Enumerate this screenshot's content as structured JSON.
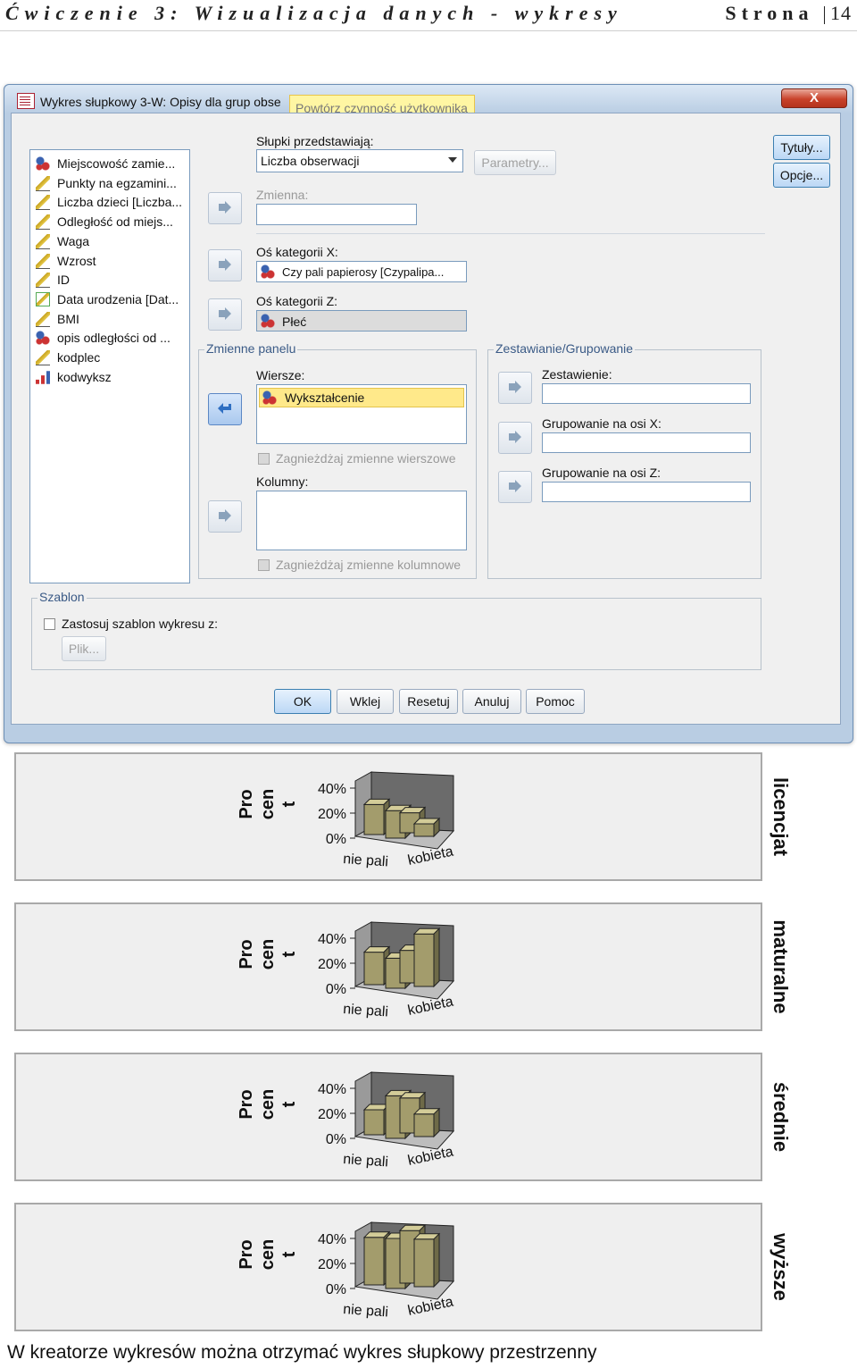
{
  "page_header": {
    "title": "Ćwiczenie 3: Wizualizacja danych - wykresy",
    "page_label": "Strona",
    "page_number": "14"
  },
  "dialog": {
    "title": "Wykres słupkowy 3-W: Opisy dla grup obse",
    "tooltip": "Powtórz czynność użytkownika",
    "close_icon": "X",
    "variables": [
      {
        "label": "Miejscowość zamie...",
        "icon": "nominal-icon"
      },
      {
        "label": "Punkty na egzamini...",
        "icon": "scale-icon"
      },
      {
        "label": "Liczba dzieci [Liczba...",
        "icon": "scale-icon"
      },
      {
        "label": "Odległość od miejs...",
        "icon": "scale-icon"
      },
      {
        "label": "Waga",
        "icon": "scale-icon"
      },
      {
        "label": "Wzrost",
        "icon": "scale-icon"
      },
      {
        "label": "ID",
        "icon": "scale-icon"
      },
      {
        "label": "Data urodzenia [Dat...",
        "icon": "date-icon"
      },
      {
        "label": "BMI",
        "icon": "scale-icon"
      },
      {
        "label": "opis odległości od ...",
        "icon": "nominal-icon"
      },
      {
        "label": "kodplec",
        "icon": "scale-icon"
      },
      {
        "label": "kodwyksz",
        "icon": "ordinal-icon"
      }
    ],
    "bars_represent_label": "Słupki przedstawiają:",
    "bars_represent_value": "Liczba obserwacji",
    "parameters_button": "Parametry...",
    "variable_label": "Zmienna:",
    "category_x_label": "Oś kategorii X:",
    "category_x_value": "Czy pali papierosy [Czypalipa...",
    "category_z_label": "Oś kategorii Z:",
    "category_z_value": "Płeć",
    "panel_group_title": "Zmienne panelu",
    "rows_label": "Wiersze:",
    "rows_value": "Wykształcenie",
    "nest_rows_label": "Zagnieżdżaj zmienne wierszowe",
    "columns_label": "Kolumny:",
    "nest_columns_label": "Zagnieżdżaj zmienne kolumnowe",
    "stack_group_title": "Zestawianie/Grupowanie",
    "stack_label": "Zestawienie:",
    "group_x_label": "Grupowanie na osi X:",
    "group_z_label": "Grupowanie na osi Z:",
    "titles_button": "Tytuły...",
    "options_button": "Opcje...",
    "template_group_title": "Szablon",
    "template_check_label": "Zastosuj szablon wykresu z:",
    "file_button": "Plik...",
    "ok_button": "OK",
    "paste_button": "Wklej",
    "reset_button": "Resetuj",
    "cancel_button": "Anuluj",
    "help_button": "Pomoc"
  },
  "chart_data": [
    {
      "type": "bar",
      "panel": "licencjat",
      "ylabel": "Pro cen t",
      "yticks": [
        "40%",
        "20%",
        "0%"
      ],
      "xticks": [
        "nie pali",
        "kobieta"
      ],
      "ylim": [
        0,
        40
      ],
      "values": [
        24,
        22,
        16,
        10
      ]
    },
    {
      "type": "bar",
      "panel": "maturalne",
      "ylabel": "Pro cen t",
      "yticks": [
        "40%",
        "20%",
        "0%"
      ],
      "xticks": [
        "nie pali",
        "kobieta"
      ],
      "ylim": [
        0,
        40
      ],
      "values": [
        26,
        24,
        26,
        42
      ]
    },
    {
      "type": "bar",
      "panel": "średnie",
      "ylabel": "Pro cen t",
      "yticks": [
        "40%",
        "20%",
        "0%"
      ],
      "xticks": [
        "nie pali",
        "kobieta"
      ],
      "ylim": [
        0,
        40
      ],
      "values": [
        20,
        34,
        28,
        18
      ]
    },
    {
      "type": "bar",
      "panel": "wyższe",
      "ylabel": "Pro cen t",
      "yticks": [
        "40%",
        "20%",
        "0%"
      ],
      "xticks": [
        "nie pali",
        "kobieta"
      ],
      "ylim": [
        0,
        40
      ],
      "values": [
        38,
        40,
        42,
        38
      ]
    }
  ],
  "caption": "W kreatorze wykresów można otrzymać wykres słupkowy przestrzenny",
  "colors": {
    "bar": "#a39c6c",
    "bar_top": "#d3cc98",
    "bar_side": "#6e6a48",
    "backwall": "#6b6b6b",
    "window_frame": "#b9cde3"
  }
}
